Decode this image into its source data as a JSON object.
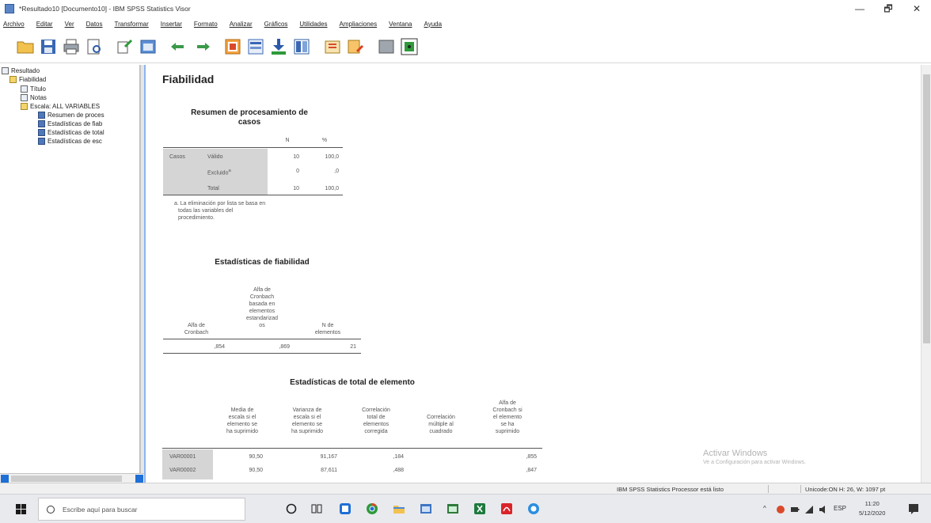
{
  "window": {
    "title": "*Resultado10 [Documento10] - IBM SPSS Statistics Visor",
    "controls": [
      "—",
      "🗗",
      "✕"
    ]
  },
  "menu": [
    "Archivo",
    "Editar",
    "Ver",
    "Datos",
    "Transformar",
    "Insertar",
    "Formato",
    "Analizar",
    "Gráficos",
    "Utilidades",
    "Ampliaciones",
    "Ventana",
    "Ayuda"
  ],
  "nav_tree": {
    "root": "Resultado",
    "fiabilidad": "Fiabilidad",
    "titulo": "Título",
    "notas": "Notas",
    "escala": "Escala: ALL VARIABLES",
    "items": [
      "Resumen de proces",
      "Estadísticas de fiab",
      "Estadísticas de total",
      "Estadísticas de esc"
    ]
  },
  "content": {
    "heading": "Fiabilidad",
    "resumen": {
      "title1": "Resumen de procesamiento de",
      "title2": "casos",
      "col_n": "N",
      "col_pct": "%",
      "group": "Casos",
      "rows": [
        {
          "label": "Válido",
          "n": "10",
          "pct": "100,0"
        },
        {
          "label": "Excluido",
          "sup": "a",
          "n": "0",
          "pct": ",0"
        },
        {
          "label": "Total",
          "n": "10",
          "pct": "100,0"
        }
      ],
      "note": [
        "a. La eliminación por lista se basa en",
        "todas las variables del",
        "procedimiento."
      ]
    },
    "fiab": {
      "title": "Estadísticas de fiabilidad",
      "col1": [
        "Alfa de",
        "Cronbach"
      ],
      "col2": [
        "Alfa de",
        "Cronbach",
        "basada en",
        "elementos",
        "estandarizad",
        "os"
      ],
      "col3": [
        "N de",
        "elementos"
      ],
      "values": [
        ",854",
        ",869",
        "21"
      ]
    },
    "total": {
      "title": "Estadísticas de total de elemento",
      "headers": [
        [
          "Media de",
          "escala si el",
          "elemento se",
          "ha suprimido"
        ],
        [
          "Varianza de",
          "escala si el",
          "elemento se",
          "ha suprimido"
        ],
        [
          "Correlación",
          "total de",
          "elementos",
          "corregida"
        ],
        [
          "Correlación",
          "múltiple al",
          "cuadrado"
        ],
        [
          "Alfa de",
          "Cronbach si",
          "el elemento",
          "se ha",
          "suprimido"
        ]
      ],
      "rows": [
        {
          "var": "VAR00001",
          "media": "90,50",
          "varianza": "91,167",
          "corr": ",184",
          "multi": "",
          "alfa": ",855"
        },
        {
          "var": "VAR00002",
          "media": "90,50",
          "varianza": "87,611",
          "corr": ",488",
          "multi": "",
          "alfa": ",847"
        }
      ]
    }
  },
  "watermark": {
    "line1": "Activar Windows",
    "line2": "Ve a Configuración para activar Windows."
  },
  "statusbar": {
    "processor": "IBM SPSS Statistics Processor está listo",
    "encoding": "Unicode:ON  H: 26, W: 1097 pt"
  },
  "taskbar": {
    "search_placeholder": "Escribe aquí para buscar",
    "lang": "ESP",
    "time": "11:20",
    "date": "5/12/2020"
  }
}
